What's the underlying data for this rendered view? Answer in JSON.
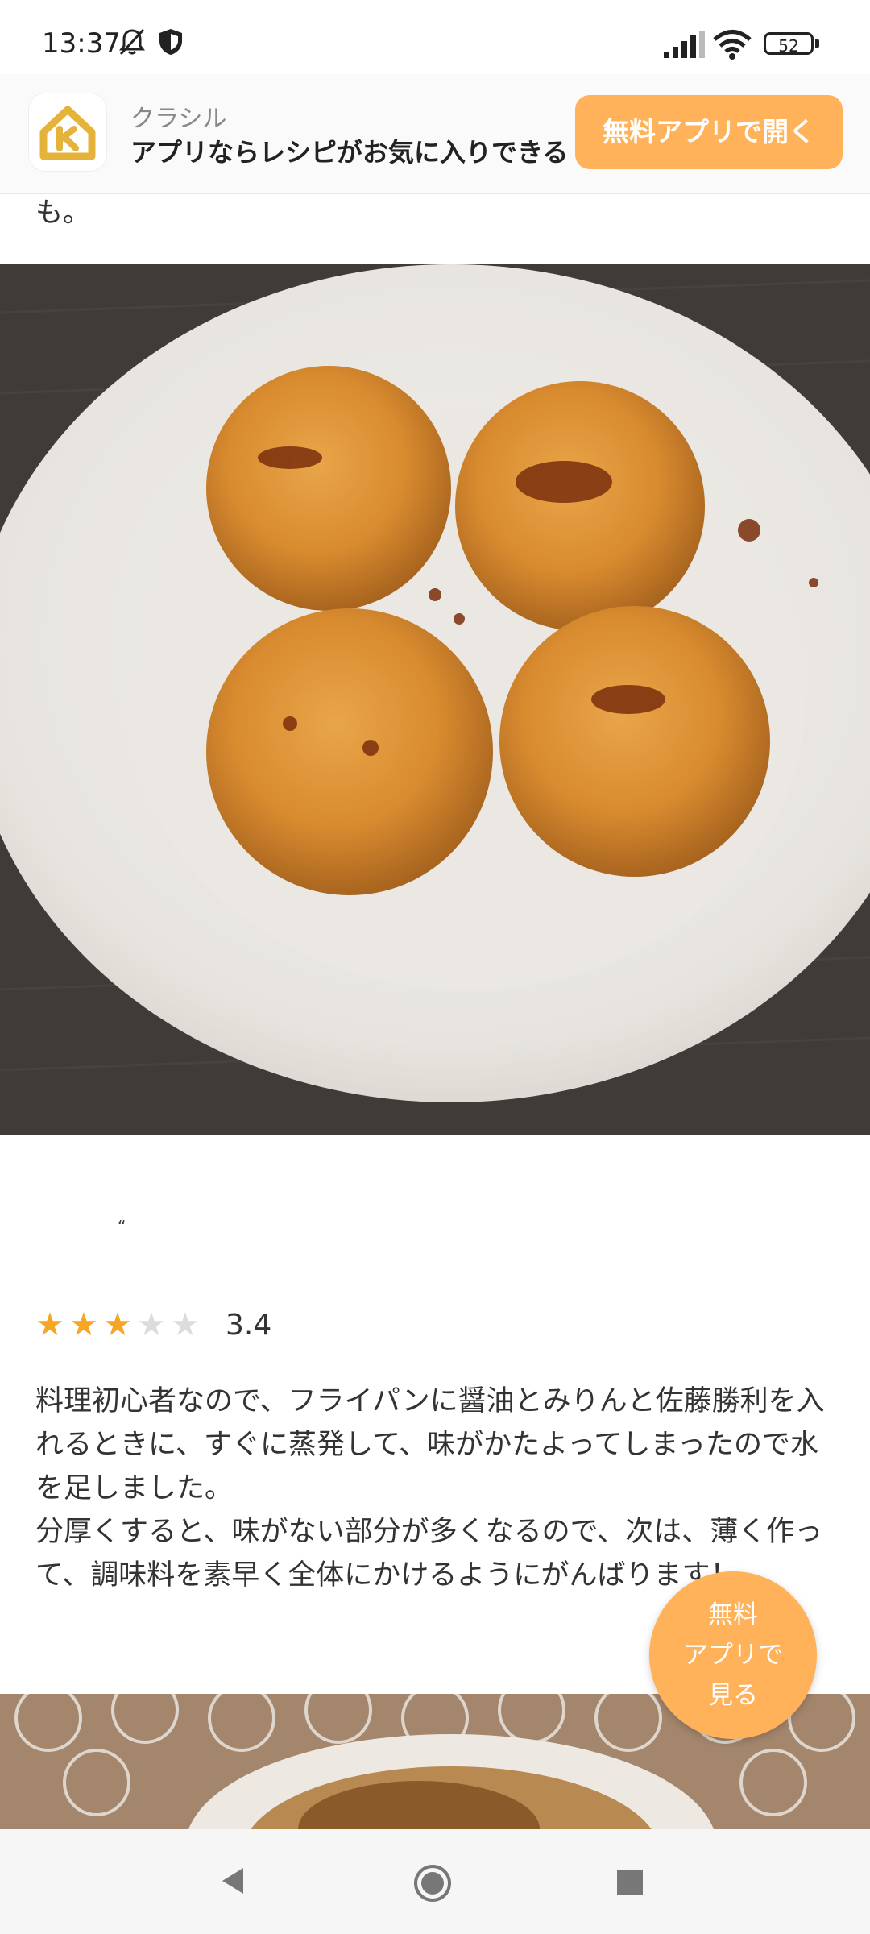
{
  "status_bar": {
    "time": "13:37",
    "battery": "52",
    "icons": [
      "bell-off-icon",
      "shield-icon",
      "signal-icon",
      "wifi-icon",
      "battery-icon"
    ]
  },
  "banner": {
    "app_name": "クラシル",
    "tagline": "アプリならレシピがお気に入りできる",
    "open_button": "無料アプリで開く",
    "accent": "#ffb25a"
  },
  "prev_text_tail": "も。",
  "review": {
    "quote_mark": "“",
    "rating": {
      "value": "3.4",
      "stars_filled": 3,
      "stars_total": 5,
      "star_color": "#f6a623"
    },
    "text": "料理初心者なので、フライパンに醤油とみりんと佐藤勝利を入れるときに、すぐに蒸発して、味がかたよってしまったので水を足しました。\n分厚くすると、味がない部分が多くなるので、次は、薄く作って、調味料を素早く全体にかけるようにがんばります！"
  },
  "fab": {
    "label_line1": "無料",
    "label_line2": "アプリで",
    "label_line3": "見る"
  },
  "nav": {
    "icons": [
      "back-icon",
      "home-icon",
      "recents-icon"
    ]
  }
}
